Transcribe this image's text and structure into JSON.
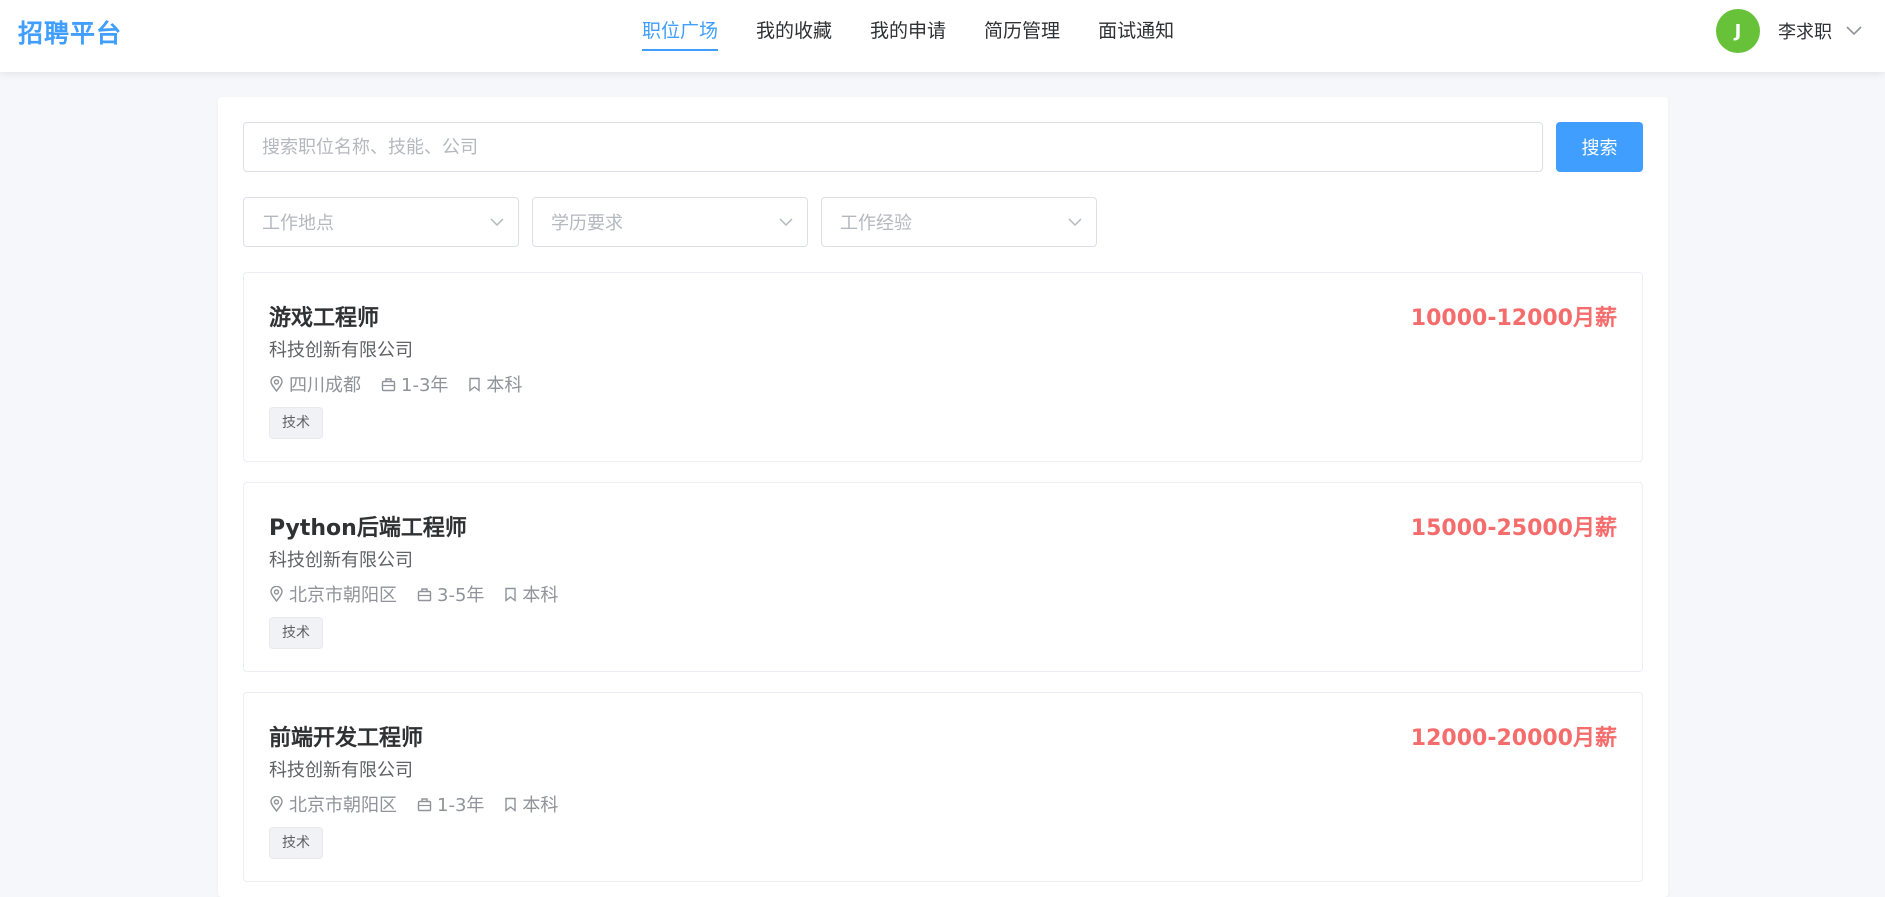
{
  "header": {
    "logo": "招聘平台",
    "nav": [
      {
        "label": "职位广场",
        "active": true
      },
      {
        "label": "我的收藏",
        "active": false
      },
      {
        "label": "我的申请",
        "active": false
      },
      {
        "label": "简历管理",
        "active": false
      },
      {
        "label": "面试通知",
        "active": false
      }
    ],
    "user": {
      "avatar_letter": "J",
      "name": "李求职",
      "caret_icon": "chevron-down-icon"
    }
  },
  "search": {
    "placeholder": "搜索职位名称、技能、公司",
    "value": "",
    "button_label": "搜索"
  },
  "filters": [
    {
      "placeholder": "工作地点",
      "icon": "chevron-down-icon"
    },
    {
      "placeholder": "学历要求",
      "icon": "chevron-down-icon"
    },
    {
      "placeholder": "工作经验",
      "icon": "chevron-down-icon"
    }
  ],
  "jobs": [
    {
      "title": "游戏工程师",
      "salary": "10000-12000月薪",
      "company": "科技创新有限公司",
      "location": "四川成都",
      "experience": "1-3年",
      "education": "本科",
      "tag": "技术"
    },
    {
      "title": "Python后端工程师",
      "salary": "15000-25000月薪",
      "company": "科技创新有限公司",
      "location": "北京市朝阳区",
      "experience": "3-5年",
      "education": "本科",
      "tag": "技术"
    },
    {
      "title": "前端开发工程师",
      "salary": "12000-20000月薪",
      "company": "科技创新有限公司",
      "location": "北京市朝阳区",
      "experience": "1-3年",
      "education": "本科",
      "tag": "技术"
    }
  ],
  "icons": {
    "location": "location-pin-icon",
    "experience": "briefcase-icon",
    "education": "bookmark-icon"
  },
  "colors": {
    "primary": "#409eff",
    "salary": "#f56c6c",
    "avatar": "#67c23a",
    "page_bg": "#f5f7fa"
  }
}
